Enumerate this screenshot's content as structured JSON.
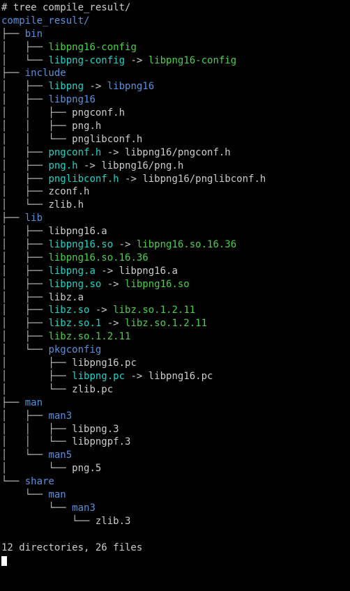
{
  "command": "# tree compile_result/",
  "root": "compile_result/",
  "tree": {
    "bin": {
      "name": "bin",
      "entries": {
        "e0": {
          "name": "libpng16-config",
          "kind": "exe"
        },
        "e1": {
          "name": "libpng-config",
          "kind": "link",
          "target": "libpng16-config",
          "tkind": "exe"
        }
      }
    },
    "include": {
      "name": "include",
      "entries": {
        "libpng": {
          "name": "libpng",
          "kind": "linkdir",
          "target": "libpng16",
          "tkind": "dir"
        },
        "libpng16": {
          "name": "libpng16",
          "kind": "dir",
          "entries": {
            "e0": {
              "name": "pngconf.h",
              "kind": "file"
            },
            "e1": {
              "name": "png.h",
              "kind": "file"
            },
            "e2": {
              "name": "pnglibconf.h",
              "kind": "file"
            }
          }
        },
        "pngconf": {
          "name": "pngconf.h",
          "kind": "link",
          "target": "libpng16/pngconf.h"
        },
        "png": {
          "name": "png.h",
          "kind": "link",
          "target": "libpng16/png.h"
        },
        "pnglibconf": {
          "name": "pnglibconf.h",
          "kind": "link",
          "target": "libpng16/pnglibconf.h"
        },
        "zconf": {
          "name": "zconf.h",
          "kind": "file"
        },
        "zlib": {
          "name": "zlib.h",
          "kind": "file"
        }
      }
    },
    "lib": {
      "name": "lib",
      "entries": {
        "e0": {
          "name": "libpng16.a",
          "kind": "file"
        },
        "e1": {
          "name": "libpng16.so",
          "kind": "link",
          "target": "libpng16.so.16.36",
          "tkind": "exe"
        },
        "e2": {
          "name": "libpng16.so.16.36",
          "kind": "exe"
        },
        "e3": {
          "name": "libpng.a",
          "kind": "link",
          "target": "libpng16.a"
        },
        "e4": {
          "name": "libpng.so",
          "kind": "link",
          "target": "libpng16.so",
          "tkind": "exe"
        },
        "e5": {
          "name": "libz.a",
          "kind": "file"
        },
        "e6": {
          "name": "libz.so",
          "kind": "link",
          "target": "libz.so.1.2.11",
          "tkind": "exe"
        },
        "e7": {
          "name": "libz.so.1",
          "kind": "link",
          "target": "libz.so.1.2.11",
          "tkind": "exe"
        },
        "e8": {
          "name": "libz.so.1.2.11",
          "kind": "exe"
        },
        "pkgconfig": {
          "name": "pkgconfig",
          "kind": "dir",
          "entries": {
            "e0": {
              "name": "libpng16.pc",
              "kind": "file"
            },
            "e1": {
              "name": "libpng.pc",
              "kind": "link",
              "target": "libpng16.pc"
            },
            "e2": {
              "name": "zlib.pc",
              "kind": "file"
            }
          }
        }
      }
    },
    "man": {
      "name": "man",
      "entries": {
        "man3": {
          "name": "man3",
          "kind": "dir",
          "entries": {
            "e0": {
              "name": "libpng.3",
              "kind": "file"
            },
            "e1": {
              "name": "libpngpf.3",
              "kind": "file"
            }
          }
        },
        "man5": {
          "name": "man5",
          "kind": "dir",
          "entries": {
            "e0": {
              "name": "png.5",
              "kind": "file"
            }
          }
        }
      }
    },
    "share": {
      "name": "share",
      "entries": {
        "man": {
          "name": "man",
          "kind": "dir",
          "entries": {
            "man3": {
              "name": "man3",
              "kind": "dir",
              "entries": {
                "e0": {
                  "name": "zlib.3",
                  "kind": "file"
                }
              }
            }
          }
        }
      }
    }
  },
  "summary": "12 directories, 26 files",
  "glyph": {
    "tee": "├── ",
    "end": "└── ",
    "pipe": "│   ",
    "space": "    ",
    "arrow": " -> "
  }
}
